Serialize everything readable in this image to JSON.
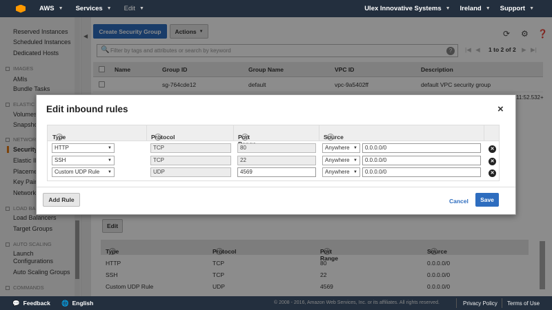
{
  "topbar": {
    "brand": "AWS",
    "services": "Services",
    "edit": "Edit",
    "account": "Ulex Innovative Systems",
    "region": "Ireland",
    "support": "Support"
  },
  "sidebar": {
    "links": [
      "Reserved Instances",
      "Scheduled Instances",
      "Dedicated Hosts"
    ],
    "images_section": "IMAGES",
    "images_links": [
      "AMIs",
      "Bundle Tasks"
    ],
    "ebs_section": "ELASTIC BLOCK STORE",
    "ebs_links": [
      "Volumes",
      "Snapshots"
    ],
    "network_section": "NETWORK & SECURITY",
    "network_links": [
      "Security Groups",
      "Elastic IPs",
      "Placement Groups",
      "Key Pairs",
      "Network Interfaces"
    ],
    "lb_section": "LOAD BALANCING",
    "lb_links": [
      "Load Balancers",
      "Target Groups"
    ],
    "as_section": "AUTO SCALING",
    "as_links": [
      "Launch Configurations",
      "Auto Scaling Groups"
    ],
    "commands_section": "COMMANDS"
  },
  "toolbar": {
    "create_label": "Create Security Group",
    "actions_label": "Actions"
  },
  "filter": {
    "placeholder": "Filter by tags and attributes or search by keyword"
  },
  "pager": {
    "text": "1 to 2 of 2"
  },
  "grid": {
    "columns": [
      "Name",
      "Group ID",
      "Group Name",
      "VPC ID",
      "Description"
    ],
    "rows": [
      [
        "",
        "sg-764cde12",
        "default",
        "vpc-9a5402ff",
        "default VPC security group"
      ]
    ],
    "truncated_text": "11:52.532+"
  },
  "inbound_panel": {
    "edit_label": "Edit",
    "columns": [
      "Type",
      "Protocol",
      "Port Range",
      "Source"
    ],
    "rows": [
      [
        "HTTP",
        "TCP",
        "80",
        "0.0.0.0/0"
      ],
      [
        "SSH",
        "TCP",
        "22",
        "0.0.0.0/0"
      ],
      [
        "Custom UDP Rule",
        "UDP",
        "4569",
        "0.0.0.0/0"
      ]
    ]
  },
  "modal": {
    "title": "Edit inbound rules",
    "close": "×",
    "columns": [
      "Type",
      "Protocol",
      "Port Range",
      "Source"
    ],
    "rules": [
      {
        "type": "HTTP",
        "protocol": "TCP",
        "port": "80",
        "source_mode": "Anywhere",
        "source": "0.0.0.0/0"
      },
      {
        "type": "SSH",
        "protocol": "TCP",
        "port": "22",
        "source_mode": "Anywhere",
        "source": "0.0.0.0/0"
      },
      {
        "type": "Custom UDP Rule",
        "protocol": "UDP",
        "port": "4569",
        "source_mode": "Anywhere",
        "source": "0.0.0.0/0"
      }
    ],
    "add_rule_label": "Add Rule",
    "cancel_label": "Cancel",
    "save_label": "Save"
  },
  "footer": {
    "feedback": "Feedback",
    "language": "English",
    "copyright": "© 2008 - 2016, Amazon Web Services, Inc. or its affiliates. All rights reserved.",
    "privacy": "Privacy Policy",
    "terms": "Terms of Use"
  },
  "colors": {
    "nav_bg": "#232f3e",
    "primary": "#2e6dbf",
    "accent": "#ff9900"
  }
}
